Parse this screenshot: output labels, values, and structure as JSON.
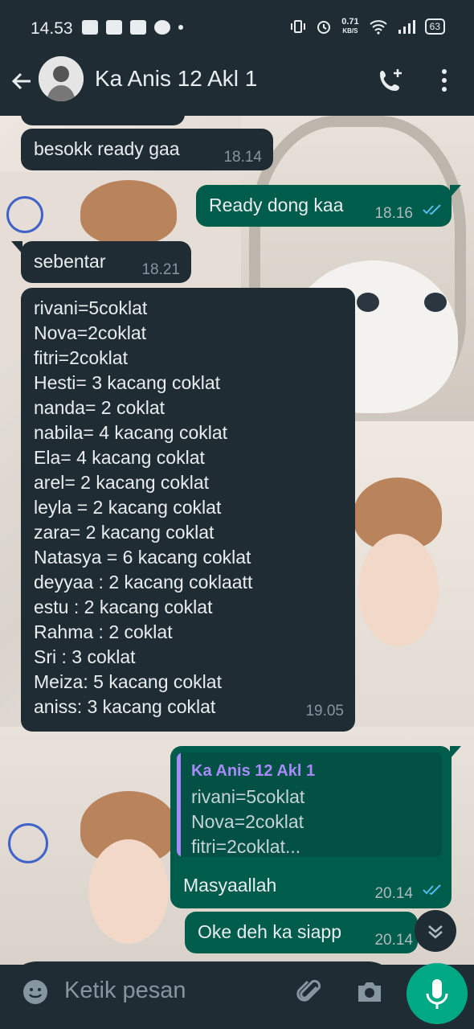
{
  "status": {
    "time": "14.53",
    "netspeed_value": "0.71",
    "netspeed_unit": "KB/S",
    "battery": "63"
  },
  "header": {
    "title": "Ka Anis 12 Akl 1"
  },
  "messages": {
    "m1": {
      "text": "besokk ready gaa",
      "time": "18.14"
    },
    "m2": {
      "text": "Ready dong kaa",
      "time": "18.16"
    },
    "m3": {
      "text": "sebentar",
      "time": "18.21"
    },
    "m4": {
      "lines": [
        "rivani=5coklat",
        "Nova=2coklat",
        "fitri=2coklat",
        "Hesti= 3 kacang coklat",
        "nanda= 2 coklat",
        "nabila= 4 kacang coklat",
        "Ela= 4 kacang coklat",
        "arel= 2 kacang coklat",
        "leyla = 2 kacang coklat",
        "zara= 2 kacang coklat",
        "Natasya = 6 kacang coklat",
        "deyyaa : 2 kacang coklaatt",
        "estu : 2 kacang coklat",
        "Rahma : 2 coklat",
        "Sri : 3 coklat",
        "Meiza: 5 kacang coklat",
        "aniss: 3 kacang coklat"
      ],
      "time": "19.05"
    },
    "m5": {
      "quote_author": "Ka Anis 12 Akl 1",
      "quote_lines": [
        "rivani=5coklat",
        "Nova=2coklat",
        "fitri=2coklat..."
      ],
      "text": "Masyaallah",
      "time": "20.14"
    },
    "m6": {
      "text": "Oke deh ka siapp",
      "time": "20.14"
    }
  },
  "composer": {
    "placeholder": "Ketik pesan"
  },
  "colors": {
    "incoming": "#202c33",
    "outgoing": "#005c4b",
    "read_tick": "#53bdeb",
    "mic": "#00a884"
  }
}
